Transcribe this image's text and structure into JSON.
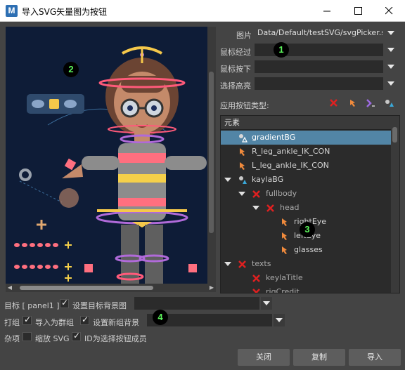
{
  "window": {
    "title": "导入SVG矢量图为按钮",
    "logo_letter": "M"
  },
  "form": {
    "image_label": "图片",
    "image_value": "Data/Default/testSVG/svgPicker.svg",
    "hover_label": "鼠标经过",
    "hover_value": "",
    "press_label": "鼠标按下",
    "press_value": "",
    "select_label": "选择高亮",
    "select_value": "",
    "button_type_label": "应用按钮类型:"
  },
  "tree": {
    "header": "元素",
    "rows": [
      {
        "label": "gradientBG",
        "selected": true
      },
      {
        "label": "R_leg_ankle_IK_CON",
        "selected": false
      },
      {
        "label": "L_leg_ankle_IK_CON",
        "selected": false
      },
      {
        "label": "kaylaBG",
        "selected": false
      },
      {
        "label": "fullbody",
        "selected": false
      },
      {
        "label": "head",
        "selected": false
      },
      {
        "label": "rightEye",
        "selected": false
      },
      {
        "label": "leftEye",
        "selected": false
      },
      {
        "label": "glasses",
        "selected": false
      },
      {
        "label": "texts",
        "selected": false
      },
      {
        "label": "keylaTitle",
        "selected": false
      },
      {
        "label": "rigCredit",
        "selected": false
      }
    ]
  },
  "bottom": {
    "target_label": "目标 [ panel1 ]",
    "set_target_bg_label": "设置目标背景图",
    "set_target_bg_checked": true,
    "target_value": "",
    "group_label": "打组",
    "import_as_group_label": "导入为群组",
    "import_as_group_checked": true,
    "set_new_group_bg_label": "设置新组背景",
    "set_new_group_bg_checked": true,
    "group_value": "",
    "misc_label": "杂项",
    "scale_svg_label": "缩放 SVG",
    "scale_svg_checked": false,
    "id_as_member_label": "ID为选择按钮成员",
    "id_as_member_checked": true
  },
  "buttons": {
    "close": "关闭",
    "copy": "复制",
    "import": "导入"
  },
  "badges": [
    "1",
    "2",
    "3",
    "4"
  ],
  "colors": {
    "canvas_bg": "#0e1c37",
    "selection": "#5285a6",
    "red_x": "#e02020",
    "orange_arrow": "#f08a3c",
    "badge_text": "#5cf55c"
  }
}
